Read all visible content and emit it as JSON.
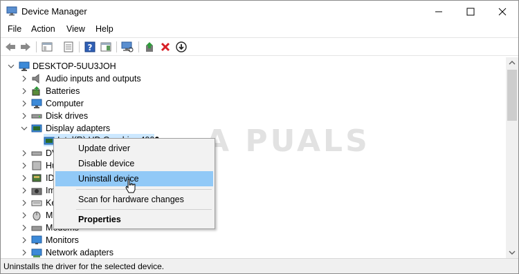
{
  "window": {
    "title": "Device Manager",
    "icon": "device-manager-icon"
  },
  "menu": {
    "items": [
      "File",
      "Action",
      "View",
      "Help"
    ]
  },
  "toolbar": {
    "icons": [
      "back-arrow-icon",
      "forward-arrow-icon",
      "show-hide-console-tree-icon",
      "properties-icon",
      "help-icon",
      "action-pane-icon",
      "scan-hardware-icon",
      "update-driver-icon",
      "uninstall-device-icon",
      "enable-device-icon"
    ]
  },
  "tree": {
    "root": "DESKTOP-5UU3JOH",
    "nodes": [
      {
        "label": "Audio inputs and outputs",
        "icon": "speaker-icon"
      },
      {
        "label": "Batteries",
        "icon": "battery-icon"
      },
      {
        "label": "Computer",
        "icon": "computer-icon"
      },
      {
        "label": "Disk drives",
        "icon": "disk-drive-icon"
      },
      {
        "label": "Display adapters",
        "icon": "display-adapter-icon"
      },
      {
        "label": "Intel(R) HD Graphics 4000",
        "icon": "display-adapter-icon"
      },
      {
        "label": "DVD/CD-ROM drives",
        "icon": "dvd-icon"
      },
      {
        "label": "Human Interface Devices",
        "icon": "hid-icon"
      },
      {
        "label": "IDE ATA/ATAPI controllers",
        "icon": "ide-icon"
      },
      {
        "label": "Imaging devices",
        "icon": "camera-icon"
      },
      {
        "label": "Keyboards",
        "icon": "keyboard-icon"
      },
      {
        "label": "Mice and other pointing devices",
        "icon": "mouse-icon"
      },
      {
        "label": "Modems",
        "icon": "modem-icon"
      },
      {
        "label": "Monitors",
        "icon": "monitor-icon"
      },
      {
        "label": "Network adapters",
        "icon": "network-icon"
      }
    ],
    "visible_labels": {
      "dvd": "DV",
      "hid": "Hu",
      "ide": "ID",
      "imaging": "Im",
      "keyboards": "Ke",
      "mice": "M",
      "modems": "Modems"
    }
  },
  "context_menu": {
    "items": [
      "Update driver",
      "Disable device",
      "Uninstall device",
      "Scan for hardware changes",
      "Properties"
    ],
    "hovered": "Uninstall device"
  },
  "status": {
    "text": "Uninstalls the driver for the selected device."
  },
  "watermark": "A PUALS",
  "colors": {
    "selection": "#cce8ff",
    "menu_hover": "#91c9f7",
    "uninstall_red": "#d81f26"
  }
}
